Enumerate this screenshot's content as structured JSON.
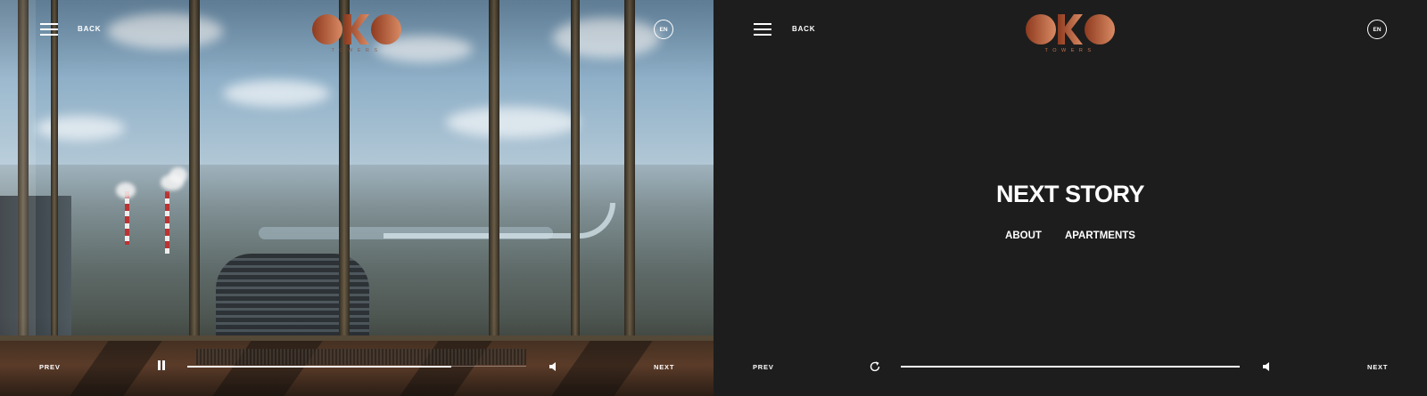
{
  "left_panel": {
    "header": {
      "back_label": "BACK",
      "lang_label": "EN",
      "logo_text": "OKO",
      "logo_sub": "TOWERS"
    },
    "controls": {
      "prev_label": "PREV",
      "next_label": "NEXT",
      "progress": 0.78,
      "state": "playing"
    }
  },
  "right_panel": {
    "header": {
      "back_label": "BACK",
      "lang_label": "EN",
      "logo_text": "OKO",
      "logo_sub": "TOWERS"
    },
    "next_story": {
      "title": "NEXT STORY",
      "links": [
        "ABOUT",
        "APARTMENTS"
      ]
    },
    "controls": {
      "prev_label": "PREV",
      "next_label": "NEXT",
      "progress": 1.0,
      "state": "ended"
    }
  },
  "icons": {
    "menu": "hamburger-icon",
    "pause": "pause-icon",
    "volume": "speaker-icon",
    "replay": "replay-icon"
  },
  "colors": {
    "logo_start": "#8e3a1f",
    "logo_end": "#d98a63",
    "panel_bg": "#1d1d1d",
    "text": "#ffffff"
  }
}
